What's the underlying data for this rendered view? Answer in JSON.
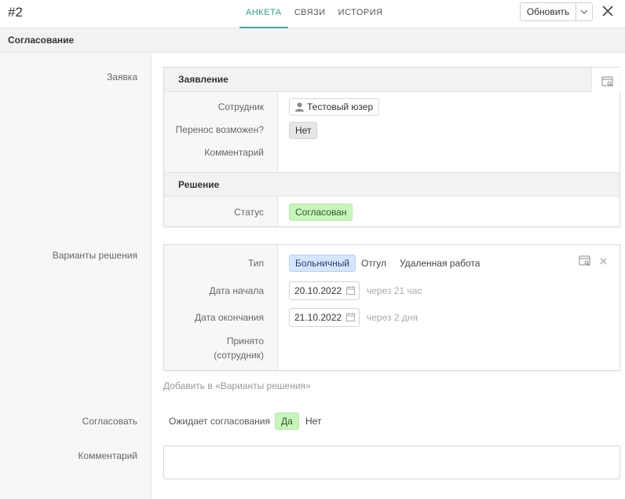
{
  "header": {
    "record_id": "#2",
    "tabs": [
      {
        "label": "АНКЕТА",
        "active": true
      },
      {
        "label": "СВЯЗИ",
        "active": false
      },
      {
        "label": "ИСТОРИЯ",
        "active": false
      }
    ],
    "update_label": "Обновить"
  },
  "section": {
    "title": "Согласование"
  },
  "application": {
    "label": "Заявка",
    "statement": {
      "header": "Заявление",
      "employee_label": "Сотрудник",
      "employee_value": "Тестовый юзер",
      "transfer_label": "Перенос возможен?",
      "transfer_value": "Нет",
      "comment_label": "Комментарий"
    },
    "decision": {
      "header": "Решение",
      "status_label": "Статус",
      "status_value": "Согласован"
    }
  },
  "variants": {
    "label": "Варианты решения",
    "type_label": "Тип",
    "types": [
      "Больничный",
      "Отгул",
      "Удаленная работа"
    ],
    "selected_type": "Больничный",
    "start_label": "Дата начала",
    "start_value": "20.10.2022",
    "start_hint": "через 21 час",
    "end_label": "Дата окончания",
    "end_value": "21.10.2022",
    "end_hint": "через 2 дня",
    "accepted_label_1": "Принято",
    "accepted_label_2": "(сотрудник)",
    "add_link": "Добавить в «Варианты решения»"
  },
  "approve": {
    "label": "Согласовать",
    "options": [
      "Ожидает согласования",
      "Да",
      "Нет"
    ],
    "selected": "Да"
  },
  "comment": {
    "label": "Комментарий",
    "value": ""
  },
  "colors": {
    "accent": "#4aa896",
    "green_chip": "#c9f5bd",
    "blue_chip": "#d5e5fb"
  }
}
